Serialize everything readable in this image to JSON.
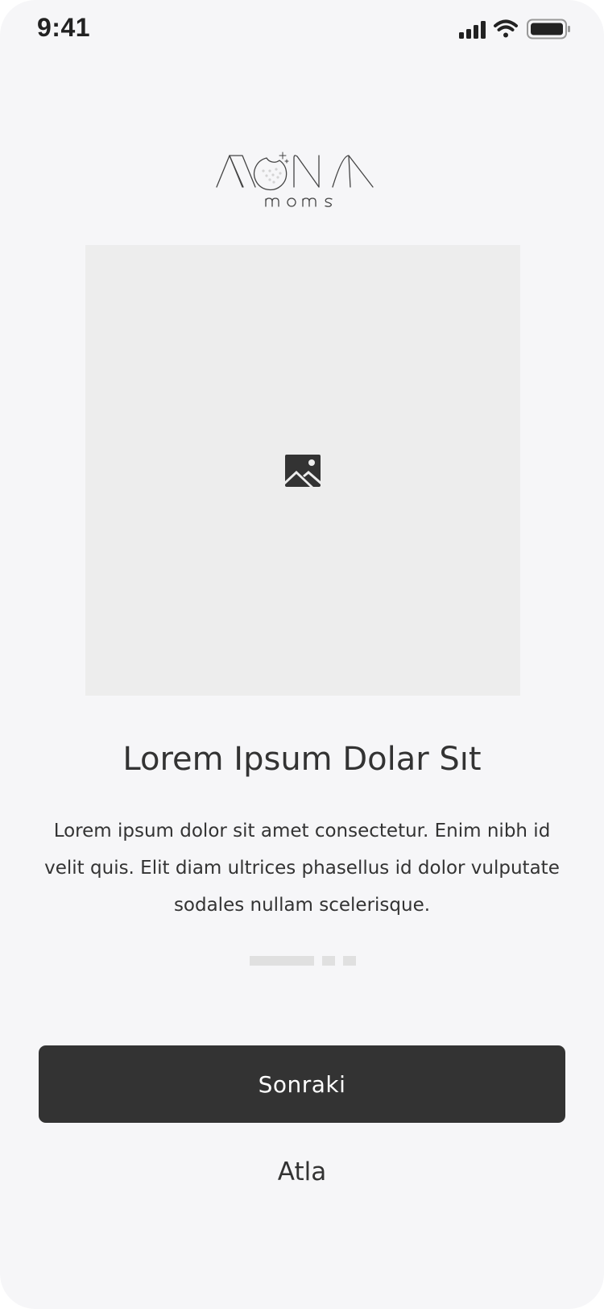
{
  "status_bar": {
    "time": "9:41",
    "icons": [
      "cellular-signal-icon",
      "wifi-icon",
      "battery-icon"
    ]
  },
  "logo": {
    "brand": "MONA",
    "subtitle": "moms"
  },
  "hero_image": {
    "icon": "image-placeholder-icon"
  },
  "content": {
    "title": "Lorem Ipsum Dolar Sıt",
    "description": "Lorem ipsum dolor sit amet consectetur. Enim nibh id velit quis. Elit diam ultrices phasellus id dolor vulputate sodales nullam scelerisque."
  },
  "pager": {
    "total_pages": 3,
    "current_page": 1
  },
  "actions": {
    "next_label": "Sonraki",
    "skip_label": "Atla"
  },
  "colors": {
    "background": "#f6f6f8",
    "placeholder": "#ededed",
    "primary": "#333333",
    "pager_inactive": "#e0e0e0"
  }
}
